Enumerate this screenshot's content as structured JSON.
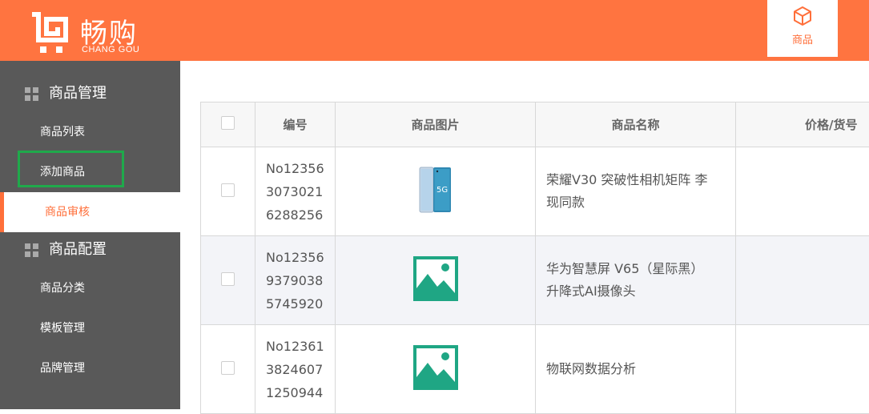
{
  "brand": {
    "name": "畅购",
    "subtitle": "CHANG GOU",
    "color": "#ff7440"
  },
  "top_tabs": [
    {
      "label": "商品",
      "icon": "box-icon"
    }
  ],
  "sidebar": {
    "groups": [
      {
        "title": "商品管理",
        "icon": "grid-icon",
        "items": [
          {
            "label": "商品列表"
          },
          {
            "label": "添加商品",
            "highlighted": true
          },
          {
            "label": "商品审核",
            "active": true
          }
        ]
      },
      {
        "title": "商品配置",
        "icon": "grid-icon",
        "items": [
          {
            "label": "商品分类"
          },
          {
            "label": "模板管理"
          },
          {
            "label": "品牌管理"
          }
        ]
      }
    ]
  },
  "table": {
    "headers": {
      "id": "编号",
      "image": "商品图片",
      "name": "商品名称",
      "price": "价格/货号"
    },
    "rows": [
      {
        "id_lines": [
          "No12356",
          "3073021",
          "6288256"
        ],
        "image": "phone-image",
        "name_lines": [
          "荣耀V30 突破性相机矩阵 李",
          "现同款"
        ],
        "price": ""
      },
      {
        "id_lines": [
          "No12356",
          "9379038",
          "5745920"
        ],
        "image": "placeholder-image",
        "name_lines": [
          "华为智慧屏 V65（星际黑）",
          "升降式AI摄像头"
        ],
        "price": ""
      },
      {
        "id_lines": [
          "No12361",
          "3824607",
          "1250944"
        ],
        "image": "placeholder-image",
        "name_lines": [
          "物联网数据分析"
        ],
        "price": ""
      }
    ]
  },
  "colors": {
    "accent": "#ff6f3a",
    "sidebar_bg": "#595959",
    "highlight": "#1fa94b",
    "placeholder_green": "#1fa684"
  }
}
